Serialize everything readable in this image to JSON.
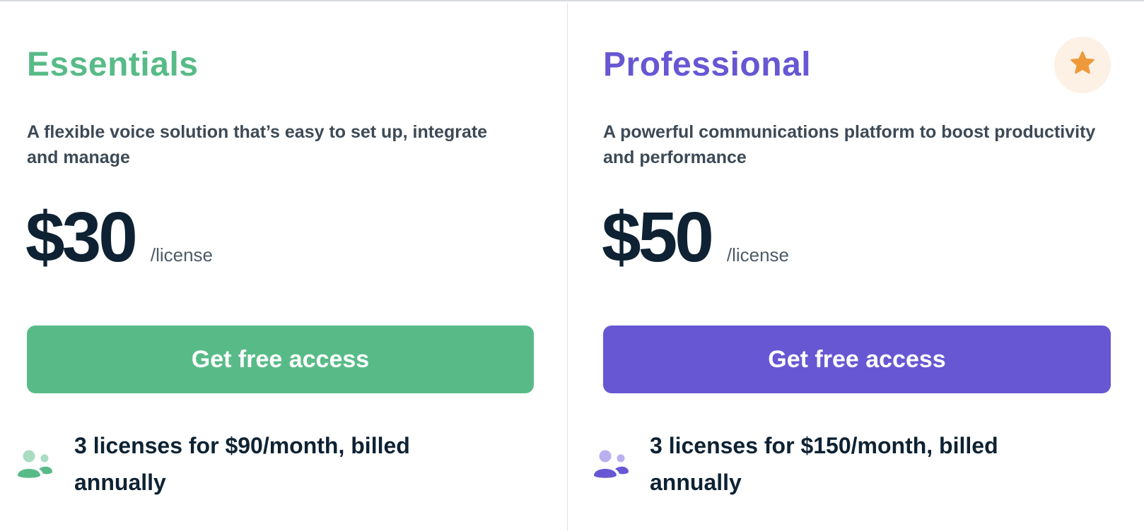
{
  "colors": {
    "essentials_accent": "#58bb87",
    "professional_accent": "#6757d3",
    "star_color": "#ee9a3a",
    "star_bg": "#fdf1e6",
    "text_dark": "#0e2233",
    "text_muted": "#3d4a56"
  },
  "plans": [
    {
      "title": "Essentials",
      "description": "A flexible voice solution that’s easy to set up, integrate and manage",
      "price": "$30",
      "per": "/license",
      "cta_label": "Get free access",
      "feature_icon": "users-icon",
      "feature_text": "3 licenses for $90/month, billed annually"
    },
    {
      "title": "Professional",
      "description": "A powerful communications platform to boost productivity and performance",
      "price": "$50",
      "per": "/license",
      "cta_label": "Get free access",
      "feature_icon": "users-icon",
      "badge_icon": "star-icon",
      "feature_text": "3 licenses for $150/month, billed annually"
    }
  ]
}
